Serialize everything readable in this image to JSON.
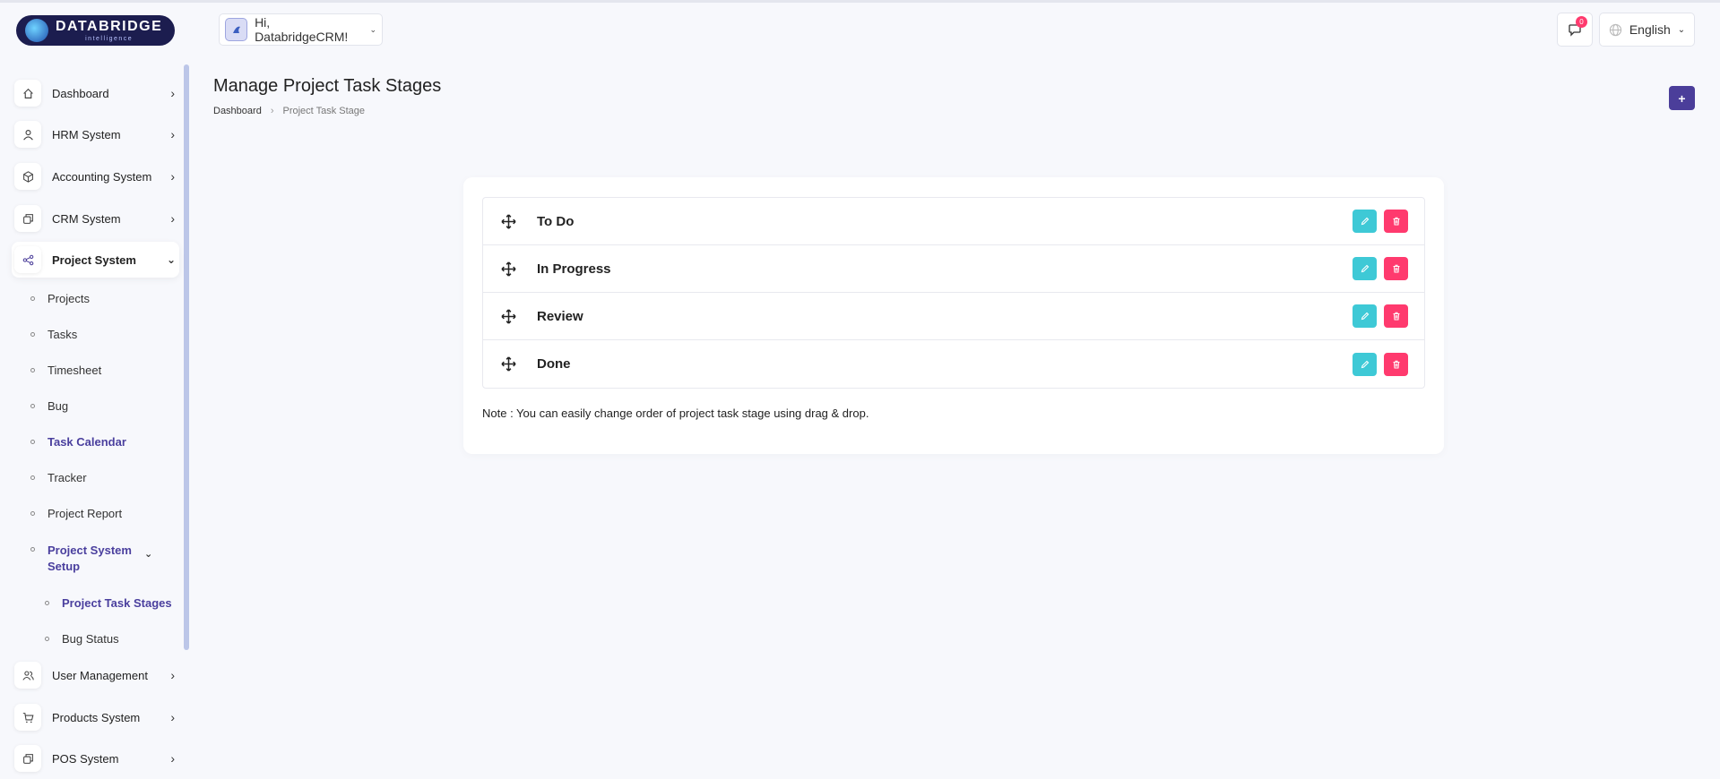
{
  "brand": {
    "name": "DATABRIDGE",
    "tagline": "intelligence"
  },
  "header": {
    "greeting": "Hi, DatabridgeCRM!",
    "notification_count": "0",
    "language": "English"
  },
  "sidebar": {
    "items": [
      {
        "label": "Dashboard",
        "icon": "home-icon"
      },
      {
        "label": "HRM System",
        "icon": "user-icon"
      },
      {
        "label": "Accounting System",
        "icon": "box-icon"
      },
      {
        "label": "CRM System",
        "icon": "layers-icon"
      },
      {
        "label": "Project System",
        "icon": "share-icon"
      }
    ],
    "project_sub": [
      "Projects",
      "Tasks",
      "Timesheet",
      "Bug",
      "Task Calendar",
      "Tracker",
      "Project Report",
      "Project System Setup"
    ],
    "setup_sub": [
      "Project Task Stages",
      "Bug Status"
    ],
    "lower_items": [
      {
        "label": "User Management",
        "icon": "users-icon"
      },
      {
        "label": "Products System",
        "icon": "cart-icon"
      },
      {
        "label": "POS System",
        "icon": "layers-icon"
      }
    ]
  },
  "main": {
    "title": "Manage Project Task Stages",
    "breadcrumb": [
      "Dashboard",
      "Project Task Stage"
    ],
    "add_label": "+",
    "stages": [
      "To Do",
      "In Progress",
      "Review",
      "Done"
    ],
    "note": "Note : You can easily change order of project task stage using drag & drop."
  },
  "colors": {
    "accent": "#4b3e9a",
    "edit": "#3ec9d6",
    "delete": "#ff3a6e",
    "brand_bg": "#1c1d4f"
  }
}
